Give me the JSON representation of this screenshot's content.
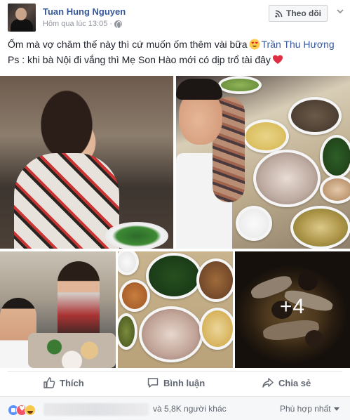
{
  "post": {
    "author": "Tuan Hung Nguyen",
    "timestamp": "Hôm qua lúc 13:05 ·",
    "follow_label": "Theo dõi",
    "text_line1_before": "Ốm mà vợ chăm thế này thì cứ muốn ốm thêm vài bữa",
    "mention": "Trần Thu Hương",
    "text_line2": "Ps : khi bà Nội đi vắng thì Mẹ Son Hào mới có dịp trổ tài đây",
    "emoji_line1": "heart-eyes-emoji",
    "emoji_line2": "red-heart-emoji"
  },
  "photos": {
    "more_count": "+4"
  },
  "actions": {
    "like_label": "Thích",
    "comment_label": "Bình luận",
    "share_label": "Chia sẻ"
  },
  "footer": {
    "reaction_count": "và 5,8K người khác",
    "sort_label": "Phù hợp nhất"
  },
  "colors": {
    "link": "#365899",
    "muted": "#90949c",
    "action_text": "#606770"
  }
}
